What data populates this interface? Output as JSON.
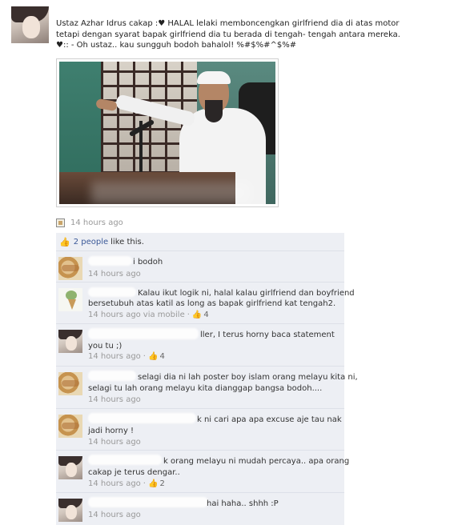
{
  "post": {
    "line1": "Ustaz Azhar Idrus cakap :♥ HALAL lelaki membonceng­kan girlfriend dia di atas motor",
    "line2": "tetapi dengan syarat bapak girlfriend dia tu berada di tengah- tengah antara mereka.",
    "line3": "♥:: - Oh ustaz.. kau sungguh bodoh bahalol! %#$%#^$%#",
    "timestamp": "14 hours ago",
    "photo_icon": "preacher-photo"
  },
  "likes": {
    "icon": "thumbs-up-icon",
    "count_text": "2 people",
    "rest": "like this."
  },
  "comments": [
    {
      "avatar": "food-avatar",
      "lines": [
        "i bodoh"
      ],
      "time": "14 hours ago",
      "via": "",
      "likes": ""
    },
    {
      "avatar": "icecream-avatar",
      "lines": [
        "Kalau ikut logik ni, halal kalau girlfriend dan boyfriend",
        "bersetubuh atas katil as long as bapak girlfriend kat tengah2."
      ],
      "time": "14 hours ago",
      "via": "via mobile",
      "likes": "4"
    },
    {
      "avatar": "girl-avatar",
      "lines": [
        "ller, I terus horny baca statement",
        "you tu ;)"
      ],
      "time": "14 hours ago",
      "via": "",
      "likes": "4"
    },
    {
      "avatar": "food-avatar",
      "lines": [
        "selagi dia ni lah poster boy islam orang melayu kita ni,",
        "selagi tu lah orang melayu kita dianggap bangsa bodoh...."
      ],
      "time": "14 hours ago",
      "via": "",
      "likes": ""
    },
    {
      "avatar": "food-avatar",
      "lines": [
        "k ni cari apa apa excuse aje tau nak",
        "jadi horny !"
      ],
      "time": "14 hours ago",
      "via": "",
      "likes": ""
    },
    {
      "avatar": "girl-avatar",
      "lines": [
        "k orang melayu ni mudah percaya.. apa orang",
        "cakap je terus dengar.."
      ],
      "time": "14 hours ago",
      "via": "",
      "likes": "2"
    },
    {
      "avatar": "girl-avatar",
      "lines": [
        "hai haha.. shhh :P"
      ],
      "time": "14 hours ago",
      "via": "",
      "likes": ""
    }
  ]
}
